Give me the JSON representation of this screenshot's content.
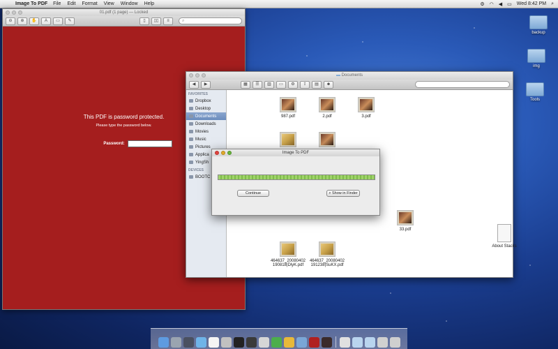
{
  "menubar": {
    "app_name": "Image To PDF",
    "menus": [
      "File",
      "Edit",
      "Format",
      "View",
      "Window",
      "Help"
    ],
    "clock": "Wed 8:42 PM"
  },
  "preview": {
    "title": "01.pdf (1 page) — Locked",
    "message": "This PDF is password protected.",
    "sub_message": "Please type the password below.",
    "password_label": "Password:",
    "password_value": ""
  },
  "finder": {
    "title": "Documents",
    "search_placeholder": "",
    "sidebar_favorites_header": "FAVORITES",
    "sidebar_devices_header": "DEVICES",
    "favorites": [
      "Dropbox",
      "Desktop",
      "Documents",
      "Downloads",
      "Movies",
      "Music",
      "Pictures",
      "Applica",
      "YingSh"
    ],
    "devices": [
      "BOOTC"
    ],
    "files": [
      {
        "name": "987.pdf"
      },
      {
        "name": "2.pdf"
      },
      {
        "name": "3.pdf"
      },
      {
        "name": "33.pdf"
      },
      {
        "name": "About Stacks"
      },
      {
        "name_line1": "464637_20080402",
        "name_line2": "190818|DlyK.pdf"
      },
      {
        "name_line1": "464637_20080402",
        "name_line2": "191238|SuKX.pdf"
      }
    ]
  },
  "dialog": {
    "title": "Image To PDF",
    "progress": 1.0,
    "continue_label": "Continue",
    "show_in_finder_label": "Show in Finder"
  },
  "desktop": {
    "icons": [
      "backup",
      "img",
      "Tools"
    ]
  },
  "colors": {
    "preview_bg": "#a51e1e",
    "progress_fill": "#8fca5a",
    "selection": "#6b8cbd"
  }
}
